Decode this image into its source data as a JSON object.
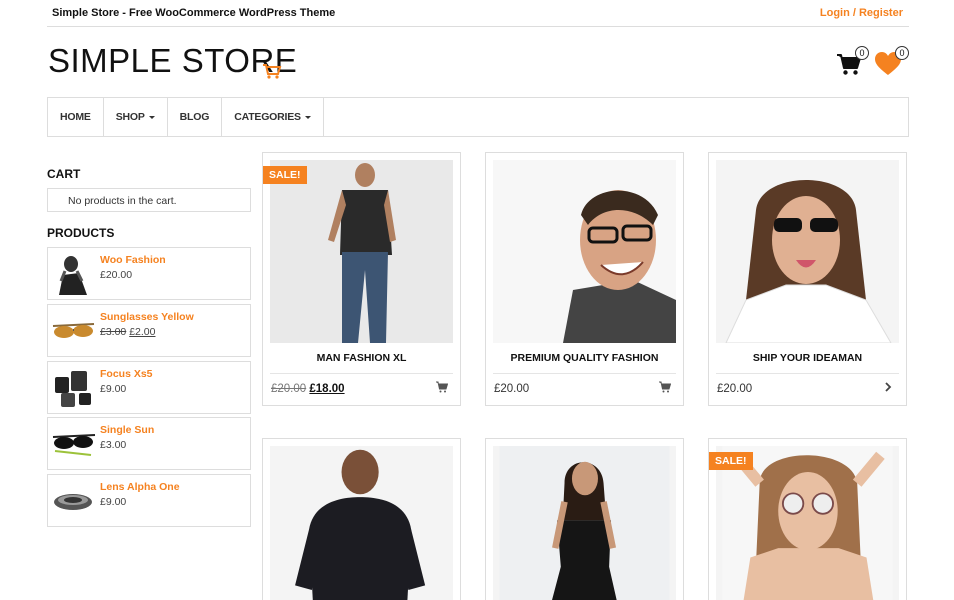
{
  "topbar": {
    "site_title": "Simple Store - Free WooCommerce WordPress Theme",
    "login_label": "Login / Register"
  },
  "header": {
    "logo_text": "SIMPLE STORE",
    "cart_count": "0",
    "wishlist_count": "0"
  },
  "nav": {
    "items": [
      {
        "label": "HOME"
      },
      {
        "label": "SHOP"
      },
      {
        "label": "BLOG"
      },
      {
        "label": "CATEGORIES"
      }
    ]
  },
  "sidebar": {
    "cart_title": "CART",
    "cart_empty": "No products in the cart.",
    "products_title": "PRODUCTS",
    "products": [
      {
        "name": "Woo Fashion",
        "price": "£20.00"
      },
      {
        "name": "Sunglasses Yellow",
        "old_price": "£3.00",
        "price": "£2.00"
      },
      {
        "name": "Focus Xs5",
        "price": "£9.00"
      },
      {
        "name": "Single Sun",
        "price": "£3.00"
      },
      {
        "name": "Lens Alpha One",
        "price": "£9.00"
      }
    ]
  },
  "grid": {
    "sale_label": "SALE!",
    "cards": [
      {
        "title": "MAN FASHION XL",
        "old_price": "£20.00",
        "price": "£18.00"
      },
      {
        "title": "PREMIUM QUALITY FASHION",
        "price": "£20.00"
      },
      {
        "title": "SHIP YOUR IDEAMAN",
        "price": "£20.00"
      }
    ]
  },
  "colors": {
    "accent": "#f58220",
    "border": "#dddddd"
  }
}
